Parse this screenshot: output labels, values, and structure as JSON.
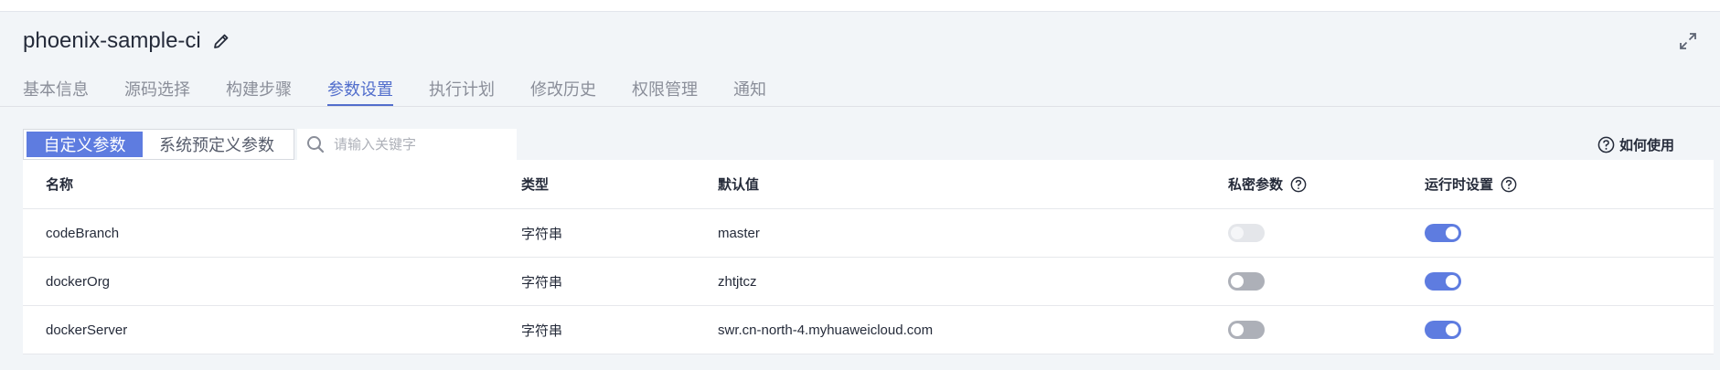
{
  "header": {
    "title": "phoenix-sample-ci"
  },
  "tabs": [
    {
      "label": "基本信息",
      "active": false
    },
    {
      "label": "源码选择",
      "active": false
    },
    {
      "label": "构建步骤",
      "active": false
    },
    {
      "label": "参数设置",
      "active": true
    },
    {
      "label": "执行计划",
      "active": false
    },
    {
      "label": "修改历史",
      "active": false
    },
    {
      "label": "权限管理",
      "active": false
    },
    {
      "label": "通知",
      "active": false
    }
  ],
  "segment": {
    "custom_label": "自定义参数",
    "system_label": "系统预定义参数",
    "selected": "custom"
  },
  "search": {
    "placeholder": "请输入关键字",
    "value": ""
  },
  "help": {
    "label": "如何使用"
  },
  "table": {
    "columns": [
      "名称",
      "类型",
      "默认值",
      "私密参数",
      "运行时设置"
    ],
    "rows": [
      {
        "name": "codeBranch",
        "type": "字符串",
        "default": "master",
        "private": "disabled",
        "runtime": "on"
      },
      {
        "name": "dockerOrg",
        "type": "字符串",
        "default": "zhtjtcz",
        "private": "off",
        "runtime": "on"
      },
      {
        "name": "dockerServer",
        "type": "字符串",
        "default": "swr.cn-north-4.myhuaweicloud.com",
        "private": "off",
        "runtime": "on"
      }
    ]
  },
  "colors": {
    "accent": "#5e7ce0",
    "tab_active": "#526ecc",
    "toggle_off": "#adb0b8",
    "toggle_disabled": "#e4e6ea"
  },
  "icons": {
    "edit": "pencil-icon",
    "expand": "expand-icon",
    "search": "search-icon",
    "help": "question-circle-icon"
  }
}
